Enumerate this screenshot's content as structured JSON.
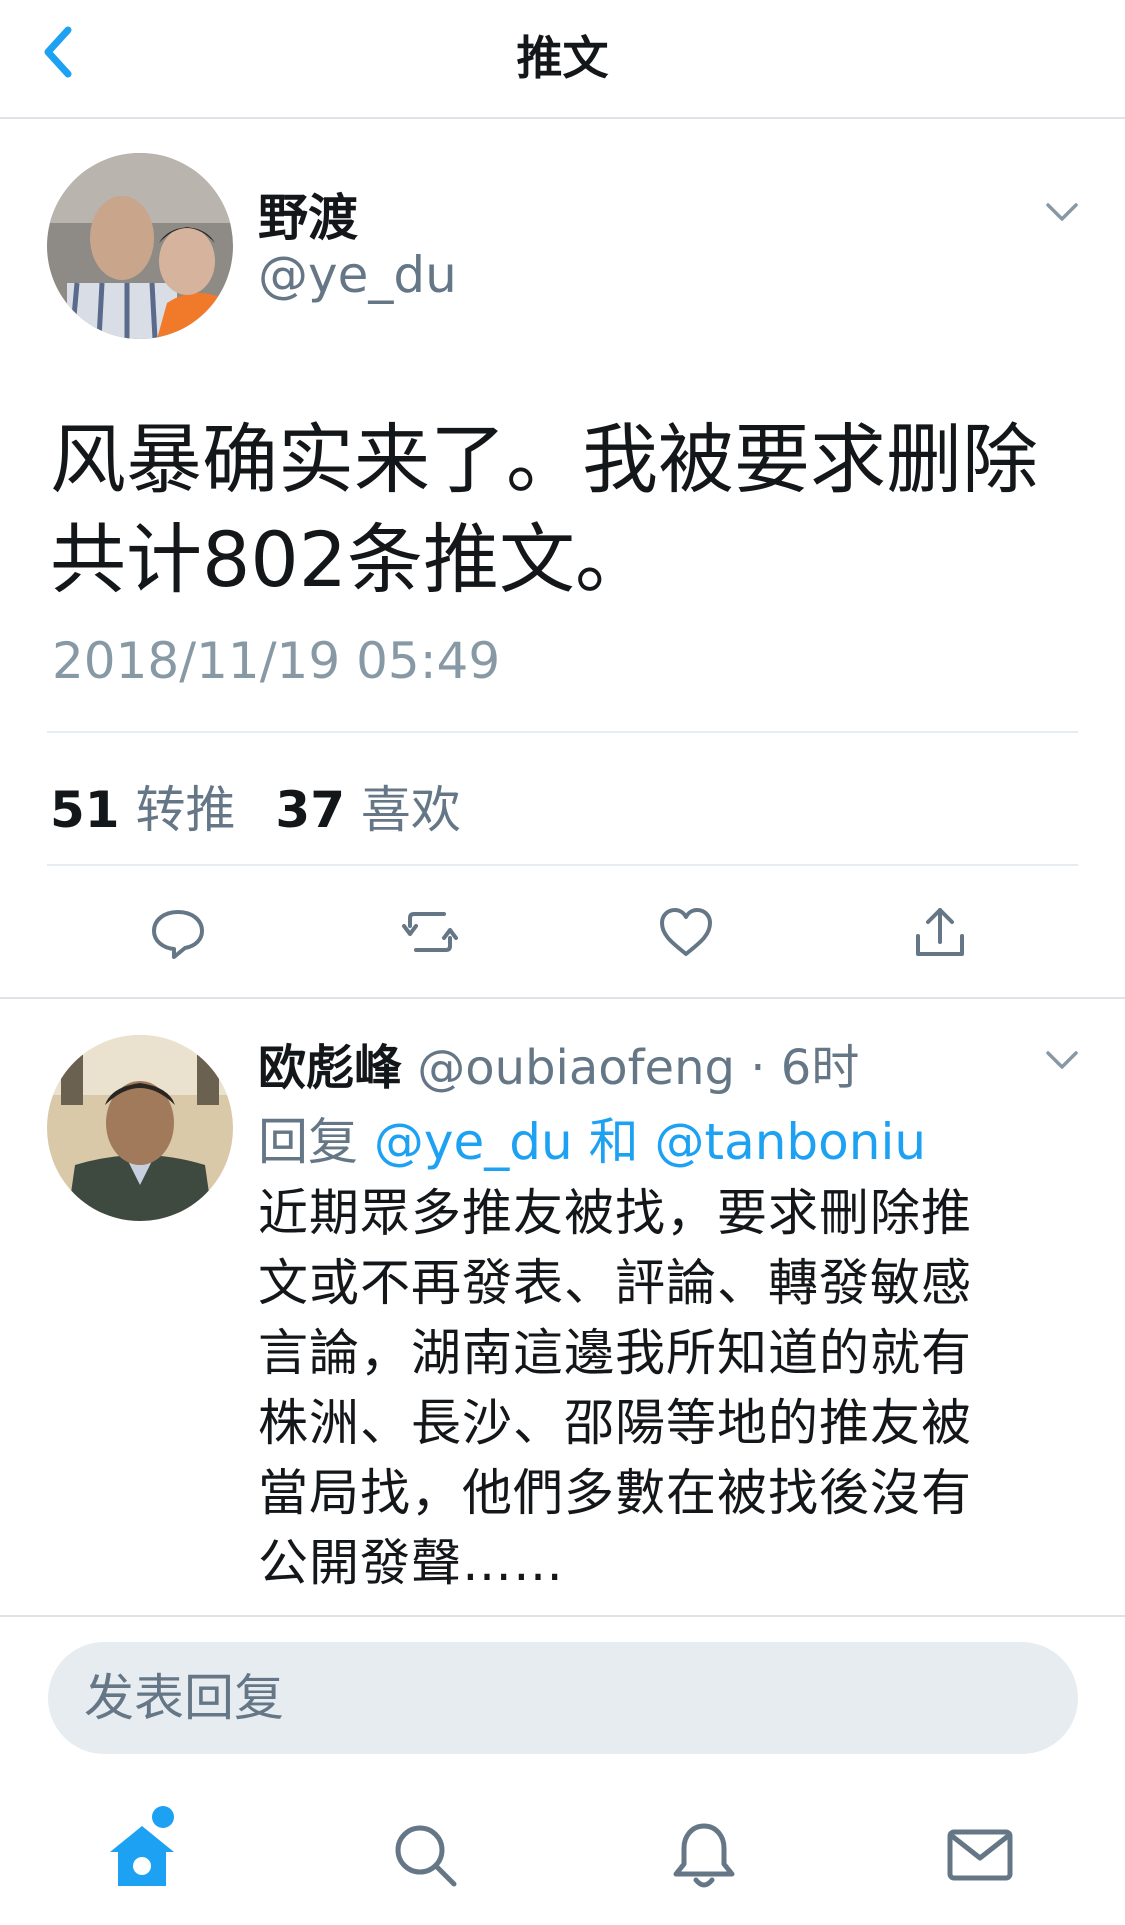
{
  "header": {
    "title": "推文"
  },
  "tweet": {
    "author_name": "野渡",
    "author_handle": "@ye_du",
    "text_line1": "风暴确实来了。我被要求删除",
    "text_line2": "共计802条推文。",
    "timestamp": "2018/11/19 05:49",
    "retweet_count": "51",
    "retweet_label": "转推",
    "like_count": "37",
    "like_label": "喜欢"
  },
  "reply": {
    "author_name": "欧彪峰",
    "author_handle": "@oubiaofeng",
    "separator": "·",
    "time": "6时",
    "replying_prefix": "回复",
    "mention1": "@ye_du",
    "conjunction": "和",
    "mention2": "@tanboniu",
    "lines": [
      "近期眾多推友被找，要求刪除推",
      "文或不再發表、評論、轉發敏感",
      "言論，湖南這邊我所知道的就有",
      "株洲、長沙、邵陽等地的推友被",
      "當局找，他們多數在被找後沒有",
      "公開發聲……"
    ]
  },
  "compose": {
    "placeholder": "发表回复"
  },
  "colors": {
    "accent": "#1da1f2",
    "gray": "#657786",
    "light_gray": "#8899a6"
  },
  "icons": {
    "back": "chevron-left-icon",
    "caret": "chevron-down-icon",
    "actions": [
      "reply-icon",
      "retweet-icon",
      "like-icon",
      "share-icon"
    ],
    "tabs": [
      "home-icon",
      "search-icon",
      "notifications-icon",
      "messages-icon"
    ]
  }
}
